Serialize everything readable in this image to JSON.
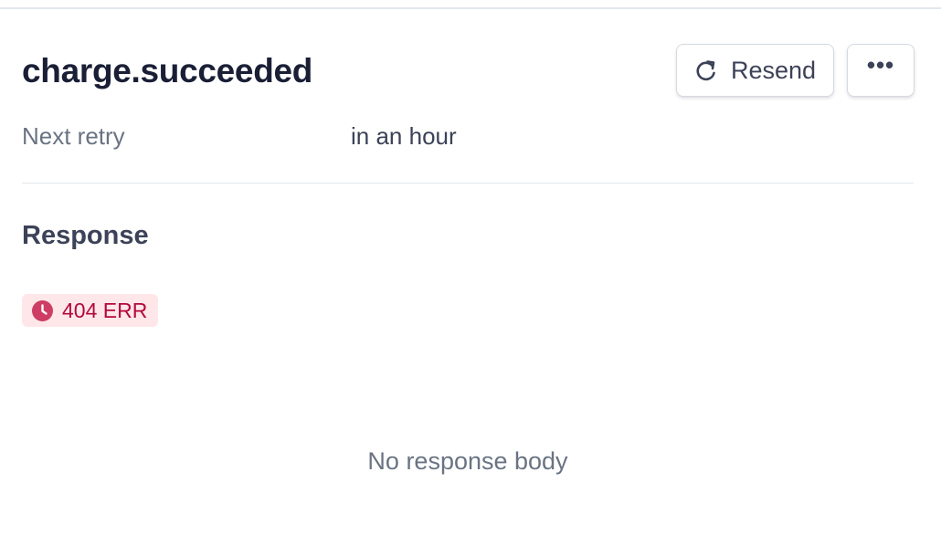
{
  "event": {
    "title": "charge.succeeded"
  },
  "actions": {
    "resend_label": "Resend",
    "resend_icon": "retry-arrow-icon",
    "more_label": "•••",
    "more_icon": "more-horizontal-icon"
  },
  "details": {
    "next_retry_label": "Next retry",
    "next_retry_value": "in an hour"
  },
  "response": {
    "heading": "Response",
    "status_text": "404 ERR",
    "status_icon": "clock-icon",
    "status_color": "#b3093c",
    "status_bg": "#ffe7e9",
    "empty_message": "No response body"
  }
}
